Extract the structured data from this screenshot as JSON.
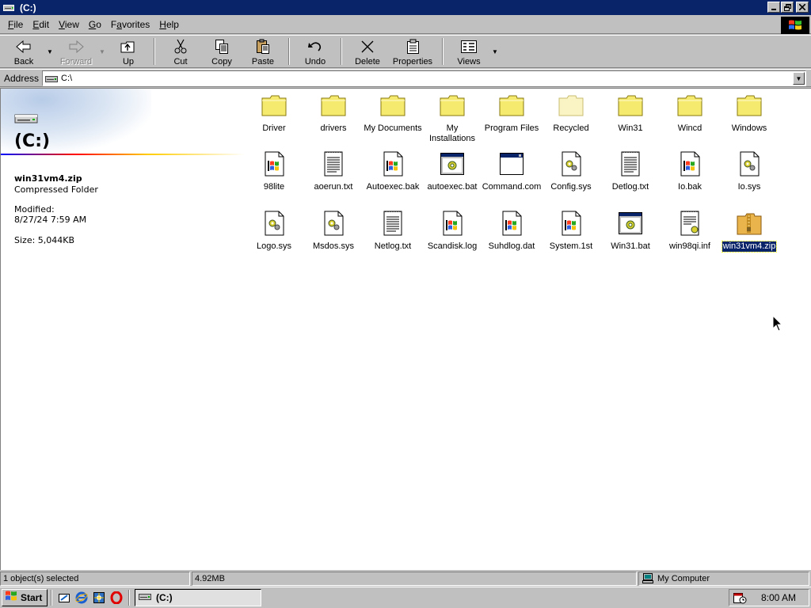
{
  "window": {
    "title": "(C:)"
  },
  "menu": [
    "File",
    "Edit",
    "View",
    "Go",
    "Favorites",
    "Help"
  ],
  "menu_accel": [
    "F",
    "E",
    "V",
    "G",
    "a",
    "H"
  ],
  "toolbar": {
    "back": "Back",
    "forward": "Forward",
    "up": "Up",
    "cut": "Cut",
    "copy": "Copy",
    "paste": "Paste",
    "undo": "Undo",
    "delete": "Delete",
    "properties": "Properties",
    "views": "Views"
  },
  "address": {
    "label": "Address",
    "value": "C:\\"
  },
  "left_pane": {
    "drive_title": "(C:)",
    "item_name": "win31vm4.zip",
    "item_type": "Compressed Folder",
    "modified_label": "Modified:",
    "modified_value": "8/27/24 7:59 AM",
    "size": "Size: 5,044KB"
  },
  "files": [
    {
      "name": "Driver",
      "icon": "folder-icon"
    },
    {
      "name": "drivers",
      "icon": "folder-icon"
    },
    {
      "name": "My Documents",
      "icon": "folder-icon"
    },
    {
      "name": "My Installations",
      "icon": "folder-icon"
    },
    {
      "name": "Program Files",
      "icon": "folder-icon"
    },
    {
      "name": "Recycled",
      "icon": "recycled-folder-icon"
    },
    {
      "name": "Win31",
      "icon": "folder-icon"
    },
    {
      "name": "Wincd",
      "icon": "folder-icon"
    },
    {
      "name": "Windows",
      "icon": "folder-icon"
    },
    {
      "name": "98lite",
      "icon": "windows-file-icon"
    },
    {
      "name": "aoerun.txt",
      "icon": "text-file-icon"
    },
    {
      "name": "Autoexec.bak",
      "icon": "windows-file-icon"
    },
    {
      "name": "autoexec.bat",
      "icon": "batch-file-icon"
    },
    {
      "name": "Command.com",
      "icon": "msdos-app-icon"
    },
    {
      "name": "Config.sys",
      "icon": "system-file-icon"
    },
    {
      "name": "Detlog.txt",
      "icon": "text-file-icon"
    },
    {
      "name": "Io.bak",
      "icon": "windows-file-icon"
    },
    {
      "name": "Io.sys",
      "icon": "system-file-icon"
    },
    {
      "name": "Logo.sys",
      "icon": "system-file-icon"
    },
    {
      "name": "Msdos.sys",
      "icon": "system-file-icon"
    },
    {
      "name": "Netlog.txt",
      "icon": "text-file-icon"
    },
    {
      "name": "Scandisk.log",
      "icon": "windows-file-icon"
    },
    {
      "name": "Suhdlog.dat",
      "icon": "windows-file-icon"
    },
    {
      "name": "System.1st",
      "icon": "windows-file-icon"
    },
    {
      "name": "Win31.bat",
      "icon": "batch-file-icon"
    },
    {
      "name": "win98qi.inf",
      "icon": "setup-info-icon"
    },
    {
      "name": "win31vm4.zip",
      "icon": "zip-folder-icon",
      "selected": true
    }
  ],
  "status": {
    "selection": "1 object(s) selected",
    "size": "4.92MB",
    "zone": "My Computer"
  },
  "taskbar": {
    "start": "Start",
    "task": "(C:)",
    "clock": "8:00 AM"
  },
  "colors": {
    "title_bar": "#0a246a",
    "selection": "#0a246a",
    "face": "#c0c0c0",
    "folder": "#f5e96e"
  }
}
